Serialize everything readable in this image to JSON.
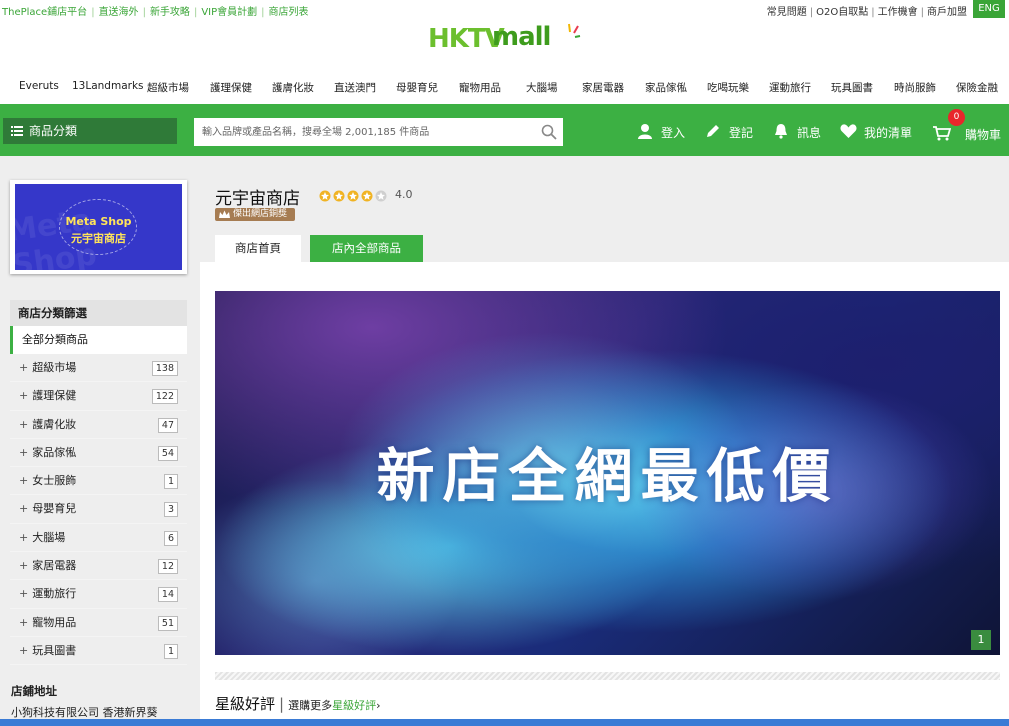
{
  "topbar": {
    "left_links": [
      "ThePlace鋪店平台",
      "直送海外",
      "新手攻略",
      "VIP會員計劃",
      "商店列表"
    ],
    "right_links": [
      "常見問題",
      "O2O自取點",
      "工作機會",
      "商戶加盟"
    ],
    "lang_button": "ENG"
  },
  "logo": {
    "text_a": "HKTV",
    "text_b": "mall"
  },
  "catnav": [
    "Everuts",
    "13Landmarks",
    "超級市場",
    "護理保健",
    "護膚化妝",
    "直送澳門",
    "母嬰育兒",
    "寵物用品",
    "大腦場",
    "家居電器",
    "家品傢俬",
    "吃喝玩樂",
    "運動旅行",
    "玩具圖書",
    "時尚服飾",
    "保險金融"
  ],
  "greenbar": {
    "category_button": "商品分類",
    "search_placeholder": "輸入品牌或產品名稱，搜尋全場 2,001,185 件商品",
    "login": "登入",
    "register": "登記",
    "messages": "訊息",
    "wishlist": "我的清單",
    "cart": "購物車",
    "cart_count": "0"
  },
  "shop": {
    "logo_en": "Meta Shop",
    "logo_zh": "元宇宙商店",
    "name": "元宇宙商店",
    "rating": "4.0",
    "rating_value": 4.0,
    "award": "傑出網店銅獎",
    "tab_home": "商店首頁",
    "tab_all": "店內全部商品"
  },
  "filter": {
    "title": "商店分類篩選",
    "all": "全部分類商品",
    "items": [
      {
        "label": "超級市場",
        "count": "138"
      },
      {
        "label": "護理保健",
        "count": "122"
      },
      {
        "label": "護膚化妝",
        "count": "47"
      },
      {
        "label": "家品傢俬",
        "count": "54"
      },
      {
        "label": "女士服飾",
        "count": "1"
      },
      {
        "label": "母嬰育兒",
        "count": "3"
      },
      {
        "label": "大腦場",
        "count": "6"
      },
      {
        "label": "家居電器",
        "count": "12"
      },
      {
        "label": "運動旅行",
        "count": "14"
      },
      {
        "label": "寵物用品",
        "count": "51"
      },
      {
        "label": "玩具圖書",
        "count": "1"
      }
    ]
  },
  "address": {
    "title": "店鋪地址",
    "text": "小狗科技有限公司 香港新界葵"
  },
  "banner": {
    "headline": "新店全網最低價",
    "page": "1"
  },
  "reviews": {
    "title": "星級好評",
    "more_prefix": "選購更多",
    "more_link": "星級好評",
    "more_arrow": "›"
  },
  "colors": {
    "brand_green": "#3cb043",
    "dark_green": "#2f7a38",
    "badge_red": "#e8262b",
    "award_brown": "#a67c52"
  }
}
